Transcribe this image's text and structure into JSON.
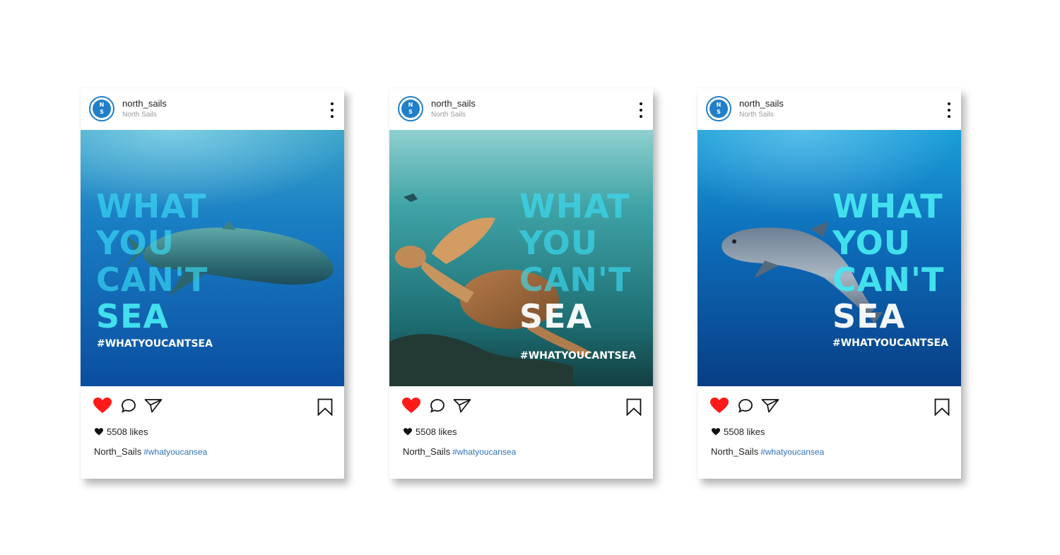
{
  "posts": [
    {
      "username": "north_sails",
      "subname": "North Sails",
      "logo_text": [
        "N",
        "S"
      ],
      "overlay_lines": [
        "WHAT",
        "YOU",
        "CAN'T",
        "SEA"
      ],
      "hashtag_overlay": "#WHATYOUCANTSEA",
      "likes": "5508 likes",
      "caption_user": "North_Sails",
      "caption_tag": "#whatyoucansea",
      "liked": true
    },
    {
      "username": "north_sails",
      "subname": "North Sails",
      "logo_text": [
        "N",
        "S"
      ],
      "overlay_lines": [
        "WHAT",
        "YOU",
        "CAN'T",
        "SEA"
      ],
      "hashtag_overlay": "#WHATYOUCANTSEA",
      "likes": "5508 likes",
      "caption_user": "North_Sails",
      "caption_tag": "#whatyoucansea",
      "liked": true
    },
    {
      "username": "north_sails",
      "subname": "North Sails",
      "logo_text": [
        "N",
        "S"
      ],
      "overlay_lines": [
        "WHAT",
        "YOU",
        "CAN'T",
        "SEA"
      ],
      "hashtag_overlay": "#WHATYOUCANTSEA",
      "likes": "5508 likes",
      "caption_user": "North_Sails",
      "caption_tag": "#whatyoucansea",
      "liked": true
    }
  ],
  "colors": {
    "like_red": "#ff1a1a",
    "brand_blue": "#1f7fc9",
    "hashtag_link": "#2f73b8"
  },
  "icons": [
    "north-sails-logo",
    "more-icon",
    "heart-icon",
    "comment-icon",
    "share-icon",
    "bookmark-icon",
    "small-heart-icon"
  ]
}
